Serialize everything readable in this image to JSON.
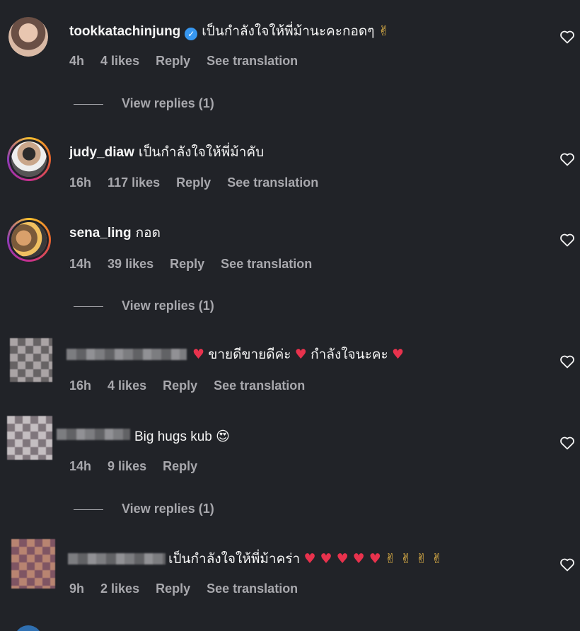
{
  "comments": [
    {
      "username": "tookkatachinjung",
      "verified": true,
      "text": "เป็นกำลังใจให้พี่ม้านะคะกอดๆ",
      "emoji": "✌",
      "time": "4h",
      "likes": "4 likes",
      "reply": "Reply",
      "translate": "See translation",
      "view_replies": "View replies (1)"
    },
    {
      "username": "judy_diaw",
      "text": "เป็นกำลังใจให้พี่ม้าคับ",
      "time": "16h",
      "likes": "117 likes",
      "reply": "Reply",
      "translate": "See translation"
    },
    {
      "username": "sena_ling",
      "text": "กอด",
      "time": "14h",
      "likes": "39 likes",
      "reply": "Reply",
      "translate": "See translation",
      "view_replies": "View replies (1)"
    },
    {
      "username": "",
      "text_parts": [
        "ขายดีขายดีค่ะ",
        "กำลังใจนะคะ"
      ],
      "emoji": "♥",
      "time": "16h",
      "likes": "4 likes",
      "reply": "Reply",
      "translate": "See translation"
    },
    {
      "username": "",
      "text": "Big hugs kub",
      "emoji": "😍",
      "time": "14h",
      "likes": "9 likes",
      "reply": "Reply",
      "view_replies": "View replies (1)"
    },
    {
      "username": "",
      "text": "เป็นกำลังใจให้พี่ม้าคร่า",
      "emoji_hearts": "♥ ♥ ♥ ♥ ♥",
      "emoji_peace": "✌ ✌ ✌ ✌",
      "time": "9h",
      "likes": "2 likes",
      "reply": "Reply",
      "translate": "See translation"
    }
  ],
  "icons": {
    "like": "heart-outline-icon",
    "verified": "verified-badge-icon"
  },
  "colors": {
    "background": "#212328",
    "muted": "#a8a8ad",
    "verified": "#3797f0",
    "heart": "#e8324d"
  }
}
